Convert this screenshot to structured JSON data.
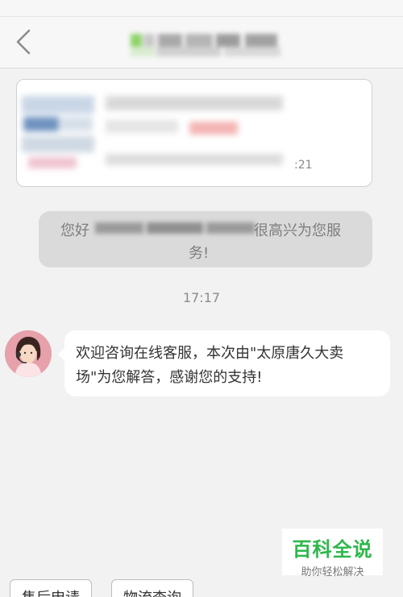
{
  "header": {
    "back_icon": "chevron-left-icon"
  },
  "welcome": {
    "prefix": "您好",
    "suffix": "很高兴为您服",
    "line2": "务!"
  },
  "chat": {
    "timestamp": "17:17",
    "agent_avatar_icon": "customer-service-avatar",
    "message": "欢迎咨询在线客服，本次由\"太原唐久大卖场\"为您解答，感谢您的支持!"
  },
  "order_card": {
    "number_fragment": ":21"
  },
  "watermark": {
    "main": "百科全说",
    "sub": "助你轻松解决"
  },
  "quick_actions": [
    "售后申请",
    "物流查询"
  ],
  "colors": {
    "brand_green": "#2db74a",
    "bubble_gray": "#dadada"
  }
}
